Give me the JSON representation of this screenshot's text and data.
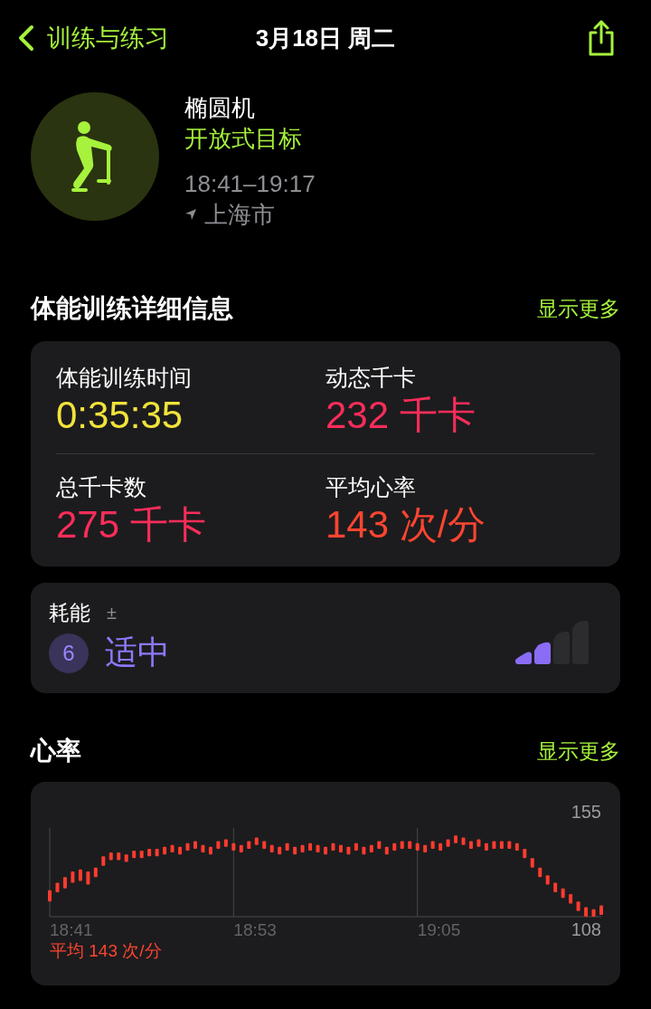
{
  "nav": {
    "back_label": "训练与练习",
    "title": "3月18日 周二"
  },
  "workout": {
    "name": "椭圆机",
    "goal": "开放式目标",
    "time_range": "18:41–19:17",
    "location": "上海市"
  },
  "details": {
    "title": "体能训练详细信息",
    "more": "显示更多",
    "stats": [
      {
        "label": "体能训练时间",
        "value": "0:35:35",
        "color": "#f2e33a"
      },
      {
        "label": "动态千卡",
        "value": "232 千卡",
        "color": "#fa2d5a"
      },
      {
        "label": "总千卡数",
        "value": "275 千卡",
        "color": "#fa2d5a"
      },
      {
        "label": "平均心率",
        "value": "143 次/分",
        "color": "#ff4530"
      }
    ]
  },
  "effort": {
    "label": "耗能",
    "symbol": "±",
    "score": "6",
    "rating": "适中",
    "level": 0.5
  },
  "heart_rate": {
    "title": "心率",
    "more": "显示更多",
    "average": "平均 143 次/分",
    "chart": {
      "time_labels": [
        "18:41",
        "18:53",
        "19:05"
      ],
      "max_label": "155",
      "min_label": "108"
    }
  }
}
